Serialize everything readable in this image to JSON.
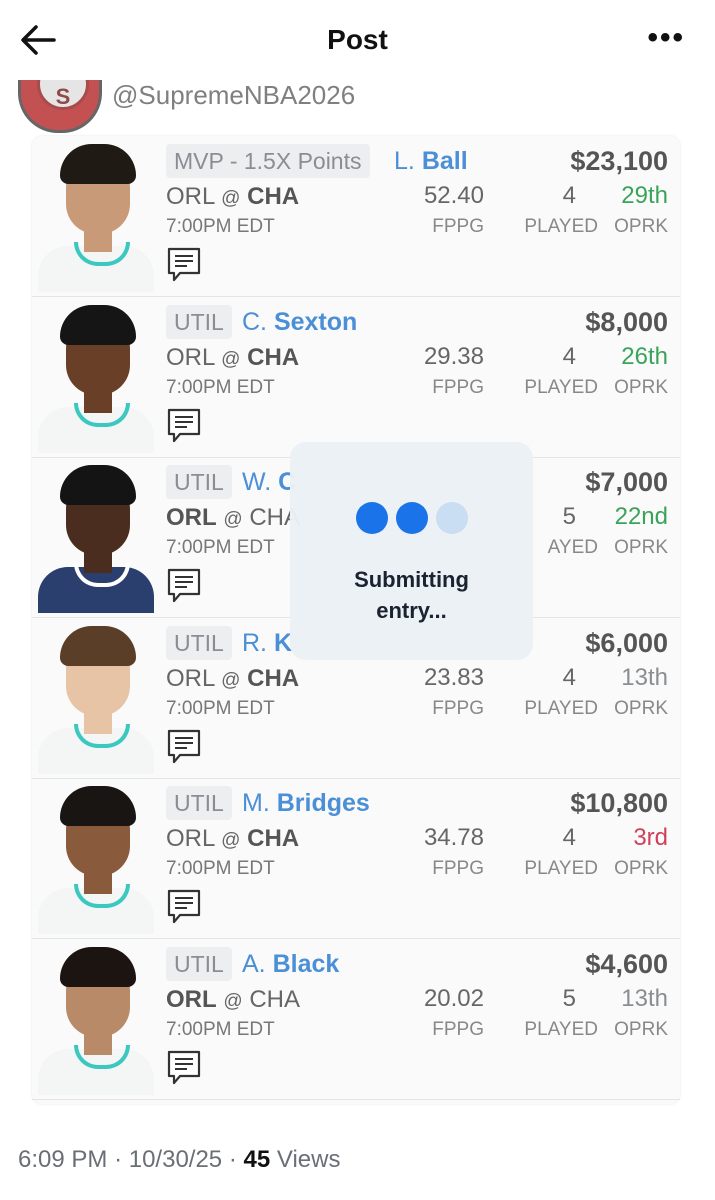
{
  "header": {
    "title": "Post",
    "back_icon": "arrow-left-icon",
    "more_icon": "more-horizontal-icon"
  },
  "post": {
    "handle": "@SupremeNBA2026",
    "time": "7:00PM EDT",
    "avatar_letter": "S"
  },
  "lineup": [
    {
      "position": "MVP - 1.5X Points",
      "first_initial": "L.",
      "last_name": "Ball",
      "salary": "$23,100",
      "team_left": "ORL",
      "at": "@",
      "team_right": "CHA",
      "bold_side": "right",
      "game_time": "7:00PM EDT",
      "fppg": "52.40",
      "fppg_label": "FPPG",
      "played": "4",
      "played_label": "PLAYED",
      "oprk": "29th",
      "oprk_color": "#3aa35a",
      "oprk_label": "OPRK",
      "skin": "#c89a78",
      "hair": "#1f1a14",
      "jersey": "#f4f6f6"
    },
    {
      "position": "UTIL",
      "first_initial": "C.",
      "last_name": "Sexton",
      "salary": "$8,000",
      "team_left": "ORL",
      "at": "@",
      "team_right": "CHA",
      "bold_side": "right",
      "game_time": "7:00PM EDT",
      "fppg": "29.38",
      "fppg_label": "FPPG",
      "played": "4",
      "played_label": "PLAYED",
      "oprk": "26th",
      "oprk_color": "#3aa35a",
      "oprk_label": "OPRK",
      "skin": "#6a3f28",
      "hair": "#151515",
      "jersey": "#f4f6f6"
    },
    {
      "position": "UTIL",
      "first_initial": "W.",
      "last_name": "C",
      "salary": "$7,000",
      "team_left": "ORL",
      "at": "@",
      "team_right": "CHA",
      "bold_side": "left",
      "game_time": "7:00PM EDT",
      "fppg": "",
      "fppg_label": "",
      "played": "5",
      "played_label": "AYED",
      "oprk": "22nd",
      "oprk_color": "#3aa35a",
      "oprk_label": "OPRK",
      "skin": "#4a2d1e",
      "hair": "#141414",
      "jersey": "#2a3f6e"
    },
    {
      "position": "UTIL",
      "first_initial": "R.",
      "last_name": "K",
      "salary": "$6,000",
      "team_left": "ORL",
      "at": "@",
      "team_right": "CHA",
      "bold_side": "right",
      "game_time": "7:00PM EDT",
      "fppg": "23.83",
      "fppg_label": "FPPG",
      "played": "4",
      "played_label": "PLAYED",
      "oprk": "13th",
      "oprk_color": "#8a8d92",
      "oprk_label": "OPRK",
      "skin": "#e8c4a6",
      "hair": "#5a3e28",
      "jersey": "#f4f6f6"
    },
    {
      "position": "UTIL",
      "first_initial": "M.",
      "last_name": "Bridges",
      "salary": "$10,800",
      "team_left": "ORL",
      "at": "@",
      "team_right": "CHA",
      "bold_side": "right",
      "game_time": "7:00PM EDT",
      "fppg": "34.78",
      "fppg_label": "FPPG",
      "played": "4",
      "played_label": "PLAYED",
      "oprk": "3rd",
      "oprk_color": "#d0405a",
      "oprk_label": "OPRK",
      "skin": "#8a5a3c",
      "hair": "#181512",
      "jersey": "#f4f6f6"
    },
    {
      "position": "UTIL",
      "first_initial": "A.",
      "last_name": "Black",
      "salary": "$4,600",
      "team_left": "ORL",
      "at": "@",
      "team_right": "CHA",
      "bold_side": "left",
      "game_time": "7:00PM EDT",
      "fppg": "20.02",
      "fppg_label": "FPPG",
      "played": "5",
      "played_label": "PLAYED",
      "oprk": "13th",
      "oprk_color": "#8a8d92",
      "oprk_label": "OPRK",
      "skin": "#b98a68",
      "hair": "#1c1410",
      "jersey": "#f4f6f6"
    }
  ],
  "overlay": {
    "line1": "Submitting",
    "line2": "entry...",
    "dot_colors": [
      "#1a73e8",
      "#1a73e8",
      "#c9ddf3"
    ]
  },
  "footer": {
    "time": "6:09 PM",
    "sep1": "·",
    "date": "10/30/25",
    "sep2": "·",
    "views_count": "45",
    "views_label": "Views"
  }
}
